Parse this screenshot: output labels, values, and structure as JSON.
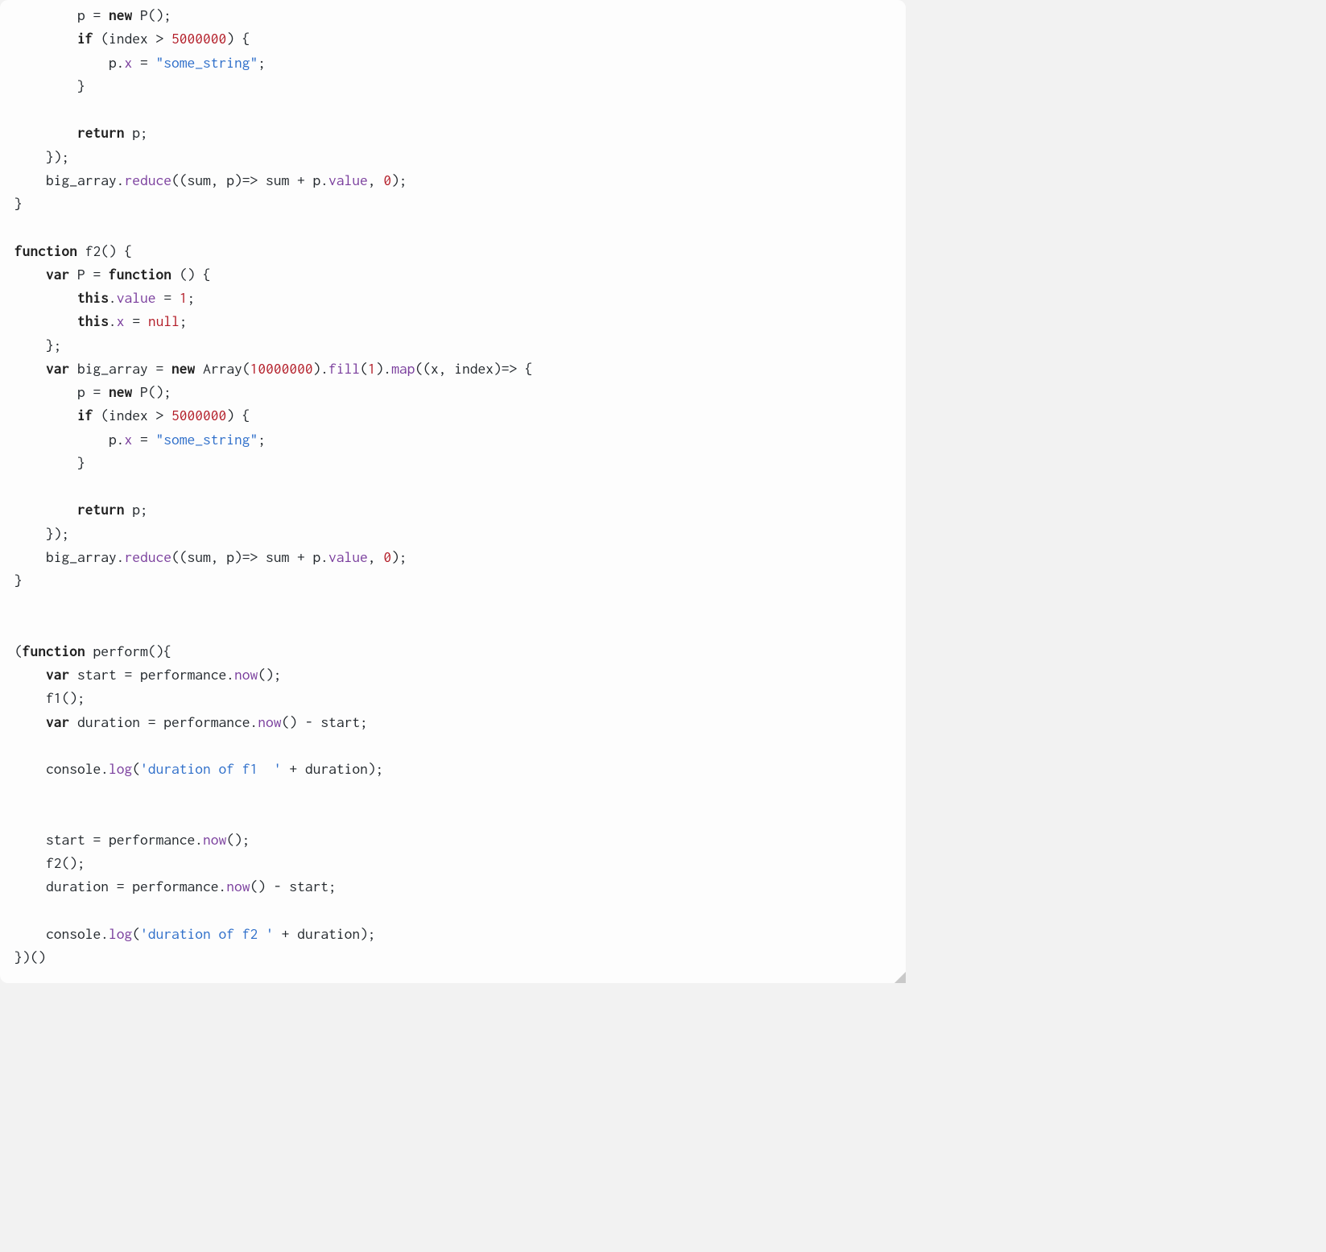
{
  "code": {
    "tokens": [
      [
        [
          "plain",
          "        p = "
        ],
        [
          "kw",
          "new"
        ],
        [
          "plain",
          " P();"
        ]
      ],
      [
        [
          "plain",
          "        "
        ],
        [
          "kw",
          "if"
        ],
        [
          "plain",
          " (index > "
        ],
        [
          "num",
          "5000000"
        ],
        [
          "plain",
          ") {"
        ]
      ],
      [
        [
          "plain",
          "            p."
        ],
        [
          "fn",
          "x"
        ],
        [
          "plain",
          " = "
        ],
        [
          "str",
          "\"some_string\""
        ],
        [
          "plain",
          ";"
        ]
      ],
      [
        [
          "plain",
          "        }"
        ]
      ],
      [
        [
          "plain",
          ""
        ]
      ],
      [
        [
          "plain",
          "        "
        ],
        [
          "kw",
          "return"
        ],
        [
          "plain",
          " p;"
        ]
      ],
      [
        [
          "plain",
          "    });"
        ]
      ],
      [
        [
          "plain",
          "    big_array."
        ],
        [
          "fn",
          "reduce"
        ],
        [
          "plain",
          "((sum, p)=> sum + p."
        ],
        [
          "fn",
          "value"
        ],
        [
          "plain",
          ", "
        ],
        [
          "num",
          "0"
        ],
        [
          "plain",
          ");"
        ]
      ],
      [
        [
          "plain",
          "}"
        ]
      ],
      [
        [
          "plain",
          ""
        ]
      ],
      [
        [
          "kw",
          "function"
        ],
        [
          "plain",
          " f2() {"
        ]
      ],
      [
        [
          "plain",
          "    "
        ],
        [
          "kw",
          "var"
        ],
        [
          "plain",
          " P = "
        ],
        [
          "kw",
          "function"
        ],
        [
          "plain",
          " () {"
        ]
      ],
      [
        [
          "plain",
          "        "
        ],
        [
          "kw",
          "this"
        ],
        [
          "plain",
          "."
        ],
        [
          "fn",
          "value"
        ],
        [
          "plain",
          " = "
        ],
        [
          "num",
          "1"
        ],
        [
          "plain",
          ";"
        ]
      ],
      [
        [
          "plain",
          "        "
        ],
        [
          "kw",
          "this"
        ],
        [
          "plain",
          "."
        ],
        [
          "fn",
          "x"
        ],
        [
          "plain",
          " = "
        ],
        [
          "nul",
          "null"
        ],
        [
          "plain",
          ";"
        ]
      ],
      [
        [
          "plain",
          "    };"
        ]
      ],
      [
        [
          "plain",
          "    "
        ],
        [
          "kw",
          "var"
        ],
        [
          "plain",
          " big_array = "
        ],
        [
          "kw",
          "new"
        ],
        [
          "plain",
          " Array("
        ],
        [
          "num",
          "10000000"
        ],
        [
          "plain",
          ")."
        ],
        [
          "fn",
          "fill"
        ],
        [
          "plain",
          "("
        ],
        [
          "num",
          "1"
        ],
        [
          "plain",
          ")."
        ],
        [
          "fn",
          "map"
        ],
        [
          "plain",
          "((x, index)=> {"
        ]
      ],
      [
        [
          "plain",
          "        p = "
        ],
        [
          "kw",
          "new"
        ],
        [
          "plain",
          " P();"
        ]
      ],
      [
        [
          "plain",
          "        "
        ],
        [
          "kw",
          "if"
        ],
        [
          "plain",
          " (index > "
        ],
        [
          "num",
          "5000000"
        ],
        [
          "plain",
          ") {"
        ]
      ],
      [
        [
          "plain",
          "            p."
        ],
        [
          "fn",
          "x"
        ],
        [
          "plain",
          " = "
        ],
        [
          "str",
          "\"some_string\""
        ],
        [
          "plain",
          ";"
        ]
      ],
      [
        [
          "plain",
          "        }"
        ]
      ],
      [
        [
          "plain",
          ""
        ]
      ],
      [
        [
          "plain",
          "        "
        ],
        [
          "kw",
          "return"
        ],
        [
          "plain",
          " p;"
        ]
      ],
      [
        [
          "plain",
          "    });"
        ]
      ],
      [
        [
          "plain",
          "    big_array."
        ],
        [
          "fn",
          "reduce"
        ],
        [
          "plain",
          "((sum, p)=> sum + p."
        ],
        [
          "fn",
          "value"
        ],
        [
          "plain",
          ", "
        ],
        [
          "num",
          "0"
        ],
        [
          "plain",
          ");"
        ]
      ],
      [
        [
          "plain",
          "}"
        ]
      ],
      [
        [
          "plain",
          ""
        ]
      ],
      [
        [
          "plain",
          ""
        ]
      ],
      [
        [
          "plain",
          "("
        ],
        [
          "kw",
          "function"
        ],
        [
          "plain",
          " perform(){"
        ]
      ],
      [
        [
          "plain",
          "    "
        ],
        [
          "kw",
          "var"
        ],
        [
          "plain",
          " start = performance."
        ],
        [
          "fn",
          "now"
        ],
        [
          "plain",
          "();"
        ]
      ],
      [
        [
          "plain",
          "    f1();"
        ]
      ],
      [
        [
          "plain",
          "    "
        ],
        [
          "kw",
          "var"
        ],
        [
          "plain",
          " duration = performance."
        ],
        [
          "fn",
          "now"
        ],
        [
          "plain",
          "() - start;"
        ]
      ],
      [
        [
          "plain",
          ""
        ]
      ],
      [
        [
          "plain",
          "    console."
        ],
        [
          "fn",
          "log"
        ],
        [
          "plain",
          "("
        ],
        [
          "str",
          "'duration of f1  '"
        ],
        [
          "plain",
          " + duration);"
        ]
      ],
      [
        [
          "plain",
          ""
        ]
      ],
      [
        [
          "plain",
          ""
        ]
      ],
      [
        [
          "plain",
          "    start = performance."
        ],
        [
          "fn",
          "now"
        ],
        [
          "plain",
          "();"
        ]
      ],
      [
        [
          "plain",
          "    f2();"
        ]
      ],
      [
        [
          "plain",
          "    duration = performance."
        ],
        [
          "fn",
          "now"
        ],
        [
          "plain",
          "() - start;"
        ]
      ],
      [
        [
          "plain",
          ""
        ]
      ],
      [
        [
          "plain",
          "    console."
        ],
        [
          "fn",
          "log"
        ],
        [
          "plain",
          "("
        ],
        [
          "str",
          "'duration of f2 '"
        ],
        [
          "plain",
          " + duration);"
        ]
      ],
      [
        [
          "plain",
          "})()"
        ]
      ]
    ]
  }
}
